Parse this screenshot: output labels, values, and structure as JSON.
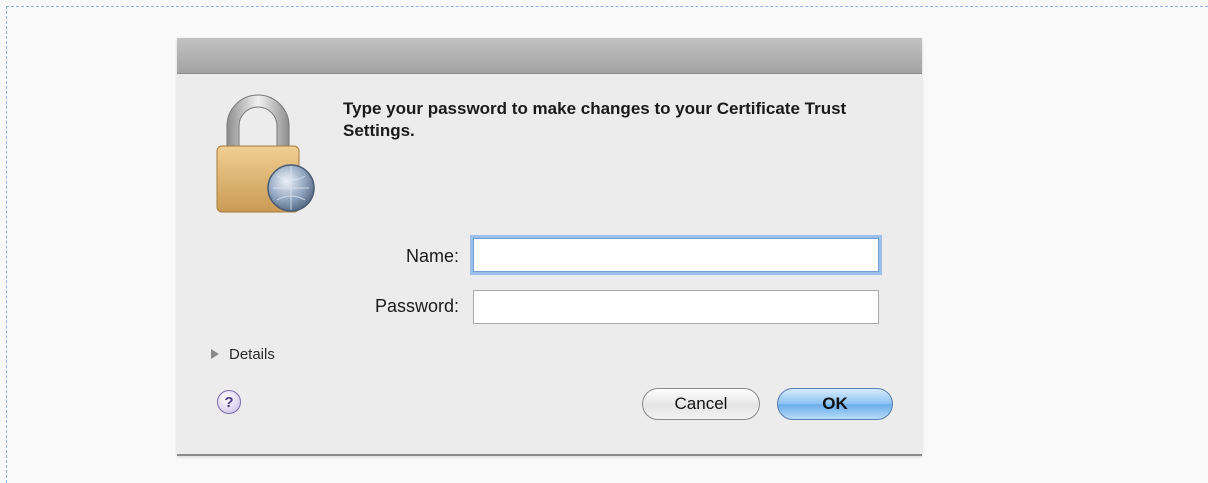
{
  "dialog": {
    "message": "Type your password to make changes to your Certificate Trust Settings.",
    "name_label": "Name:",
    "name_value": "",
    "password_label": "Password:",
    "password_value": "",
    "details_label": "Details",
    "help_label": "?",
    "cancel_label": "Cancel",
    "ok_label": "OK"
  },
  "icons": {
    "lock": "lock-icon",
    "help": "help-icon",
    "disclosure": "disclosure-triangle-icon"
  },
  "colors": {
    "focus_ring": "#9cc0ea",
    "default_button": "#8cc2f2",
    "titlebar": "#b3b3b3"
  }
}
